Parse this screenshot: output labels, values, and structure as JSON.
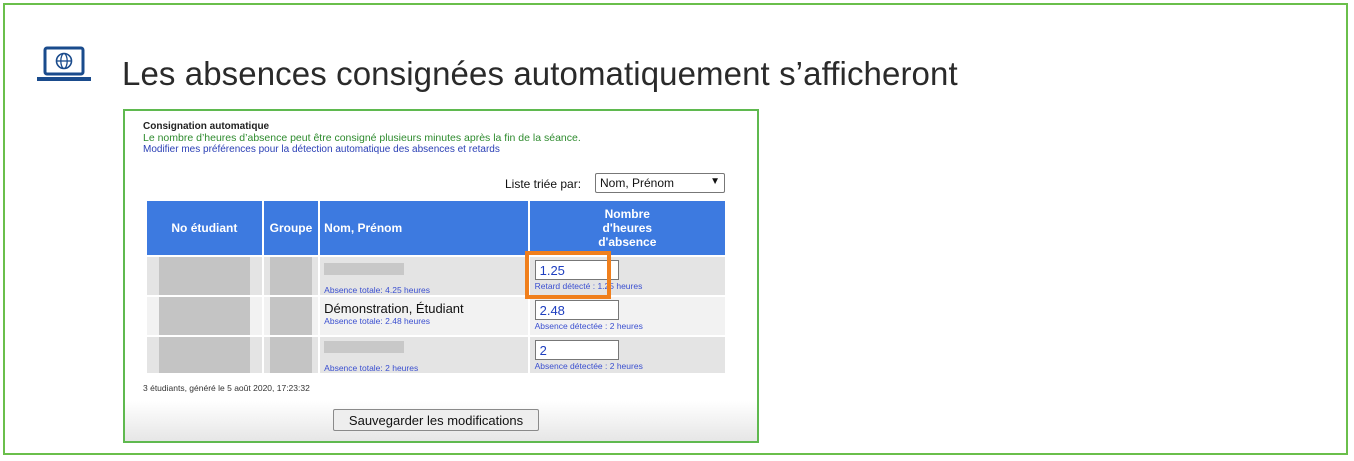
{
  "slide": {
    "heading": "Les absences consignées automatiquement s’afficheront",
    "icon": "laptop-globe-icon",
    "accent_color": "#6abf4b"
  },
  "screenshot": {
    "title": "Consignation automatique",
    "description": "Le nombre d’heures d’absence peut être consigné plusieurs minutes après la fin de la séance.",
    "preferences_link": "Modifier mes préférences pour la détection automatique des absences et retards",
    "sort": {
      "label": "Liste triée par:",
      "selected": "Nom, Prénom"
    },
    "table": {
      "headers": {
        "student_no": "No étudiant",
        "group": "Groupe",
        "name": "Nom, Prénom",
        "hours": "Nombre d'heures d'absence"
      },
      "rows": [
        {
          "name": "",
          "total": "Absence totale: 4.25 heures",
          "hours_value": "1.25",
          "hours_note": "Retard détecté : 1.25 heures"
        },
        {
          "name": "Démonstration, Étudiant",
          "total": "Absence totale: 2.48 heures",
          "hours_value": "2.48",
          "hours_note": "Absence détectée : 2 heures"
        },
        {
          "name": "",
          "total": "Absence totale: 2 heures",
          "hours_value": "2",
          "hours_note": "Absence détectée : 2 heures"
        }
      ]
    },
    "footer": "3 étudiants, généré le 5 août 2020, 17:23:32",
    "save_button": "Sauvegarder les modifications",
    "header_color": "#3d7ae0",
    "highlight_color": "#f07f1c"
  }
}
